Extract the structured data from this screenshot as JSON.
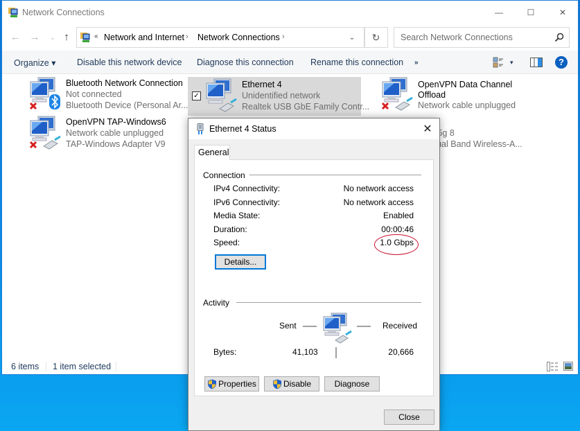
{
  "window": {
    "title": "Network Connections",
    "controls": {
      "minimize": "—",
      "maximize": "☐",
      "close": "✕"
    }
  },
  "address_bar": {
    "back": "←",
    "forward": "→",
    "recent": "⌄",
    "up": "↑",
    "overflow": "«",
    "breadcrumb": [
      "Network and Internet",
      "Network Connections"
    ],
    "separator": "›",
    "dropdown": "⌄",
    "refresh": "↻"
  },
  "search": {
    "placeholder": "Search Network Connections",
    "value": ""
  },
  "command_bar": {
    "organize": "Organize ▾",
    "disable": "Disable this network device",
    "diagnose": "Diagnose this connection",
    "rename": "Rename this connection",
    "more": "»",
    "view_dropdown": "▾",
    "help": "?"
  },
  "connections": [
    {
      "name": "Bluetooth Network Connection",
      "status": "Not connected",
      "device": "Bluetooth Device (Personal Ar...",
      "badge": "bluetooth",
      "disconnected": true,
      "selected": false
    },
    {
      "name": "Ethernet 4",
      "status": "Unidentified network",
      "device": "Realtek USB GbE Family Contr...",
      "badge": "ethernet",
      "disconnected": false,
      "selected": true,
      "checkbox": "✓"
    },
    {
      "name": "OpenVPN Data Channel Offload",
      "status": "Network cable unplugged",
      "device": "",
      "badge": "ethernet",
      "disconnected": true,
      "selected": false
    },
    {
      "name": "OpenVPN TAP-Windows6",
      "status": "Network cable unplugged",
      "device": "TAP-Windows Adapter V9",
      "badge": "ethernet",
      "disconnected": true,
      "selected": false
    },
    {
      "name": "",
      "status": "...ua-5g 8",
      "device": "...) Dual Band Wireless-A...",
      "badge": "wifi",
      "disconnected": false,
      "selected": false
    }
  ],
  "status_bar": {
    "count": "6 items",
    "selected": "1 item selected"
  },
  "dialog": {
    "title": "Ethernet 4 Status",
    "close": "✕",
    "tab": "General",
    "connection": {
      "heading": "Connection",
      "rows": [
        {
          "label": "IPv4 Connectivity:",
          "value": "No network access"
        },
        {
          "label": "IPv6 Connectivity:",
          "value": "No network access"
        },
        {
          "label": "Media State:",
          "value": "Enabled"
        },
        {
          "label": "Duration:",
          "value": "00:00:46"
        },
        {
          "label": "Speed:",
          "value": "1.0 Gbps"
        }
      ],
      "details_button": "Details..."
    },
    "activity": {
      "heading": "Activity",
      "sent_label": "Sent",
      "received_label": "Received",
      "bytes_label": "Bytes:",
      "bytes_sent": "41,103",
      "bytes_received": "20,666"
    },
    "buttons": {
      "properties": "Properties",
      "disable": "Disable",
      "diagnose": "Diagnose",
      "close": "Close"
    },
    "annotation_color": "#c8102e"
  }
}
